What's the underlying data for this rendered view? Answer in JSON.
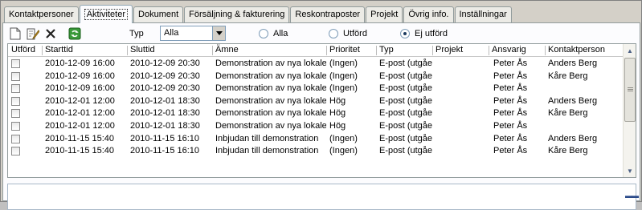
{
  "tabs": [
    {
      "label": "Kontaktpersoner",
      "active": false
    },
    {
      "label": "Aktiviteter",
      "active": true
    },
    {
      "label": "Dokument",
      "active": false
    },
    {
      "label": "Försäljning & fakturering",
      "active": false
    },
    {
      "label": "Reskontraposter",
      "active": false
    },
    {
      "label": "Projekt",
      "active": false
    },
    {
      "label": "Övrig info.",
      "active": false
    },
    {
      "label": "Inställningar",
      "active": false
    }
  ],
  "toolbar": {
    "icons": [
      "new-document-icon",
      "edit-icon",
      "delete-icon",
      "refresh-icon"
    ],
    "type_label": "Typ",
    "type_value": "Alla",
    "filters": [
      {
        "label": "Alla",
        "selected": false
      },
      {
        "label": "Utförd",
        "selected": false
      },
      {
        "label": "Ej utförd",
        "selected": true
      }
    ]
  },
  "grid": {
    "columns": [
      "Utförd",
      "Starttid",
      "Sluttid",
      "Ämne",
      "Prioritet",
      "Typ",
      "Projekt",
      "Ansvarig",
      "Kontaktperson"
    ],
    "rows": [
      {
        "done": false,
        "start": "2010-12-09 16:00",
        "end": "2010-12-09 20:30",
        "subject": "Demonstration av nya lokaler",
        "priority": "(Ingen)",
        "type": "E-post (utgående)",
        "project": "",
        "responsible": "Peter Ås",
        "contact": "Anders Berg"
      },
      {
        "done": false,
        "start": "2010-12-09 16:00",
        "end": "2010-12-09 20:30",
        "subject": "Demonstration av nya lokaler",
        "priority": "(Ingen)",
        "type": "E-post (utgående)",
        "project": "",
        "responsible": "Peter Ås",
        "contact": "Kåre Berg"
      },
      {
        "done": false,
        "start": "2010-12-09 16:00",
        "end": "2010-12-09 20:30",
        "subject": "Demonstration av nya lokaler",
        "priority": "(Ingen)",
        "type": "E-post (utgående)",
        "project": "",
        "responsible": "Peter Ås",
        "contact": ""
      },
      {
        "done": false,
        "start": "2010-12-01 12:00",
        "end": "2010-12-01 18:30",
        "subject": "Demonstration av nya lokaler",
        "priority": "Hög",
        "type": "E-post (utgående)",
        "project": "",
        "responsible": "Peter Ås",
        "contact": "Anders Berg"
      },
      {
        "done": false,
        "start": "2010-12-01 12:00",
        "end": "2010-12-01 18:30",
        "subject": "Demonstration av nya lokaler",
        "priority": "Hög",
        "type": "E-post (utgående)",
        "project": "",
        "responsible": "Peter Ås",
        "contact": "Kåre Berg"
      },
      {
        "done": false,
        "start": "2010-12-01 12:00",
        "end": "2010-12-01 18:30",
        "subject": "Demonstration av nya lokaler",
        "priority": "Hög",
        "type": "E-post (utgående)",
        "project": "",
        "responsible": "Peter Ås",
        "contact": ""
      },
      {
        "done": false,
        "start": "2010-11-15 15:40",
        "end": "2010-11-15 16:10",
        "subject": "Inbjudan till demonstration",
        "priority": "(Ingen)",
        "type": "E-post (utgående)",
        "project": "",
        "responsible": "Peter Ås",
        "contact": "Anders Berg"
      },
      {
        "done": false,
        "start": "2010-11-15 15:40",
        "end": "2010-11-15 16:10",
        "subject": "Inbjudan till demonstration",
        "priority": "(Ingen)",
        "type": "E-post (utgående)",
        "project": "",
        "responsible": "Peter Ås",
        "contact": "Kåre Berg"
      }
    ]
  },
  "notes": {
    "value": ""
  },
  "colors": {
    "window": "#d4d0c8",
    "panel": "#fcfcfe",
    "border": "#919b9c",
    "accent": "#2a4a8a"
  }
}
